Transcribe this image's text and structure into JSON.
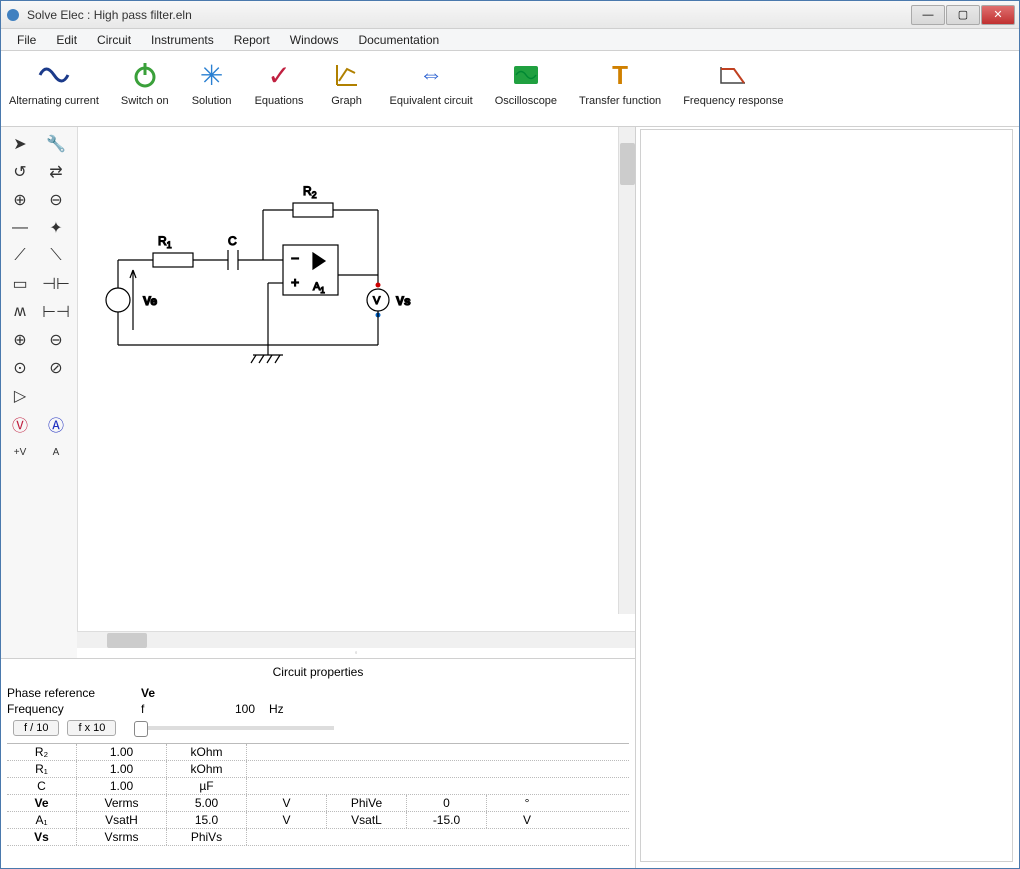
{
  "window": {
    "title": "Solve Elec : High pass filter.eln"
  },
  "menus": [
    "File",
    "Edit",
    "Circuit",
    "Instruments",
    "Report",
    "Windows",
    "Documentation"
  ],
  "toolbar": [
    {
      "id": "ac",
      "label": "Alternating current",
      "color": "#1b3a8a"
    },
    {
      "id": "switch",
      "label": "Switch on",
      "color": "#3aa03a"
    },
    {
      "id": "solution",
      "label": "Solution",
      "color": "#2a80d2"
    },
    {
      "id": "equations",
      "label": "Equations",
      "color": "#c02040"
    },
    {
      "id": "graph",
      "label": "Graph",
      "color": "#b08000"
    },
    {
      "id": "equiv",
      "label": "Equivalent circuit",
      "color": "#2a60d0"
    },
    {
      "id": "scope",
      "label": "Oscilloscope",
      "color": "#20a040"
    },
    {
      "id": "transfer",
      "label": "Transfer function",
      "color": "#d08000"
    },
    {
      "id": "freqresp",
      "label": "Frequency response",
      "color": "#c04020"
    }
  ],
  "circuit_labels": {
    "R1": "R",
    "R1sub": "1",
    "R2": "R",
    "R2sub": "2",
    "C": "C",
    "A1": "A",
    "A1sub": "1",
    "Ve": "Ve",
    "Vs": "Vs",
    "V": "V"
  },
  "properties": {
    "title": "Circuit properties",
    "phase_ref_label": "Phase reference",
    "phase_ref_value": "Ve",
    "freq_label": "Frequency",
    "freq_sym": "f",
    "freq_val": "100",
    "freq_unit": "Hz",
    "btn_div": "f / 10",
    "btn_mul": "f x 10",
    "rows": [
      {
        "name": "R₂",
        "p1": "1.00",
        "p2": "kOhm",
        "p3": "",
        "p4": "",
        "p5": "",
        "p6": ""
      },
      {
        "name": "R₁",
        "p1": "1.00",
        "p2": "kOhm",
        "p3": "",
        "p4": "",
        "p5": "",
        "p6": ""
      },
      {
        "name": "C",
        "p1": "1.00",
        "p2": "µF",
        "p3": "",
        "p4": "",
        "p5": "",
        "p6": ""
      },
      {
        "name": "Ve",
        "p1": "Verms",
        "p2": "5.00",
        "p3": "V",
        "p4": "PhiVe",
        "p5": "0",
        "p6": "°",
        "bold": true
      },
      {
        "name": "A₁",
        "p1": "VsatH",
        "p2": "15.0",
        "p3": "V",
        "p4": "VsatL",
        "p5": "-15.0",
        "p6": "V"
      },
      {
        "name": "Vs",
        "p1": "Vsrms",
        "p2": "PhiVs",
        "p3": "",
        "p4": "",
        "p5": "",
        "p6": "",
        "bold": true
      }
    ]
  }
}
